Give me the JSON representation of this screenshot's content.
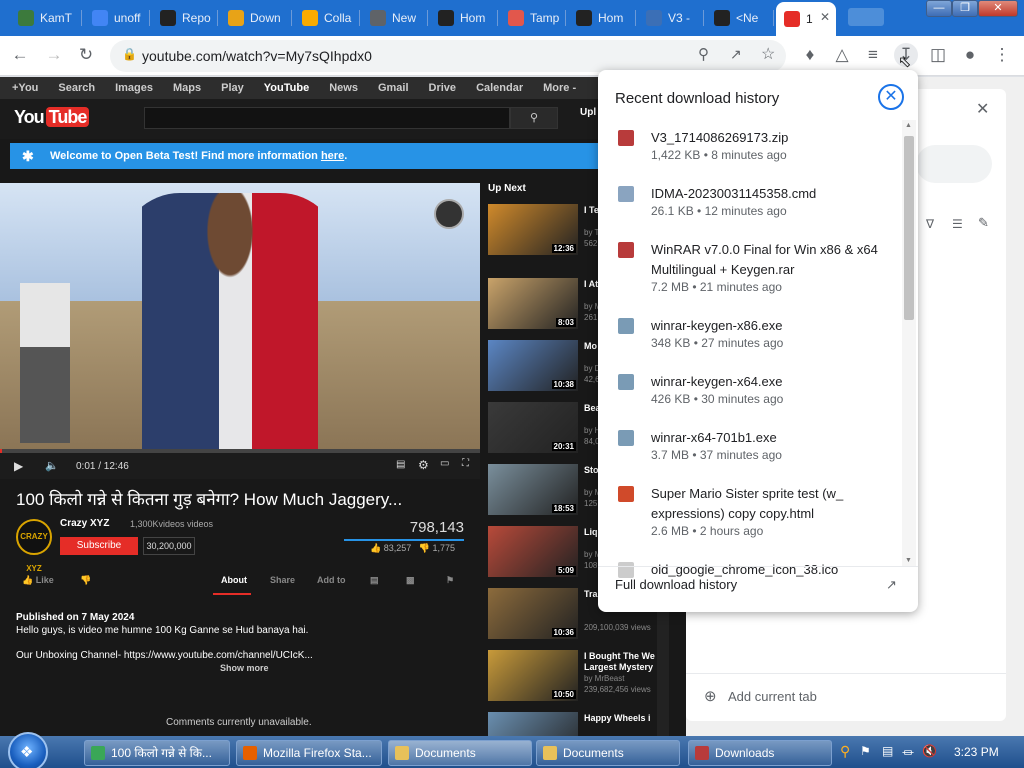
{
  "tabs": [
    {
      "label": "KamT",
      "icon": "kmt-icon",
      "color": "#3c7a3c"
    },
    {
      "label": "unoff",
      "icon": "google-icon",
      "color": "#4285f4"
    },
    {
      "label": "Repo",
      "icon": "github-icon",
      "color": "#222222"
    },
    {
      "label": "Down",
      "icon": "download-site-icon",
      "color": "#e8a317"
    },
    {
      "label": "Colla",
      "icon": "colab-icon",
      "color": "#f9ab00"
    },
    {
      "label": "New",
      "icon": "globe-icon",
      "color": "#5f6368"
    },
    {
      "label": "Hom",
      "icon": "hf-icon",
      "color": "#222222"
    },
    {
      "label": "Tamp",
      "icon": "tampermonkey-icon",
      "color": "#e2574c"
    },
    {
      "label": "Hom",
      "icon": "hf-icon",
      "color": "#222222"
    },
    {
      "label": "V3 -",
      "icon": "g-icon",
      "color": "#3b6fb6"
    },
    {
      "label": "<Ne",
      "icon": "hf-icon",
      "color": "#222222"
    },
    {
      "label": "1",
      "icon": "youtube-icon",
      "color": "#e52d27"
    }
  ],
  "window_controls": {
    "minimize": "—",
    "maximize": "❐",
    "close": "✕"
  },
  "toolbar": {
    "url": "youtube.com/watch?v=My7sQIhpdx0"
  },
  "google_bar": [
    "+You",
    "Search",
    "Images",
    "Maps",
    "Play",
    "YouTube",
    "News",
    "Gmail",
    "Drive",
    "Calendar",
    "More -"
  ],
  "youtube": {
    "logo_you": "You",
    "logo_tube": "Tube",
    "upload": "Upl",
    "banner_text": "Welcome to Open Beta Test! Find more information ",
    "banner_link": "here",
    "banner_end": ".",
    "time": "0:01 / 12:46",
    "title": "100 किलो गन्ने से कितना गुड़ बनेगा? How Much Jaggery...",
    "channel": "Crazy XYZ",
    "channel_avatar": "CRAZY XYZ",
    "channel_videos": "1,300Kvideos videos",
    "subscribe": "Subscribe",
    "sub_count": "30,200,000",
    "views": "798,143",
    "likes": "83,257",
    "dislikes": "1,775",
    "actions": {
      "like": "Like",
      "about": "About",
      "share": "Share",
      "addto": "Add to"
    },
    "published": "Published on 7 May 2024",
    "desc1": "Hello guys, is video me humne 100 Kg Ganne se Hud banaya hai.",
    "desc2": "Our Unboxing Channel- https://www.youtube.com/channel/UCIcK...",
    "show_more": "Show more",
    "comments": "Comments currently unavailable.",
    "up_next": "Up Next",
    "related": [
      {
        "title": "I Te Uni",
        "sub": "by T",
        "views": "562",
        "dur": "12:36",
        "color": "#d08a2b"
      },
      {
        "title": "I At Slic",
        "sub": "by M",
        "views": "261",
        "dur": "8:03",
        "color": "#c9a36a"
      },
      {
        "title": "Mo Dub",
        "sub": "by D",
        "views": "42,6",
        "dur": "10:38",
        "color": "#5b86c4"
      },
      {
        "title": "Bea Gar",
        "sub": "by H",
        "views": "84,0",
        "dur": "20:31",
        "color": "#3a3a3a"
      },
      {
        "title": "Sto Lan",
        "sub": "by M",
        "views": "125",
        "dur": "18:53",
        "color": "#7a8f9c"
      },
      {
        "title": "Liq Flu",
        "sub": "by M",
        "views": "108",
        "dur": "5:09",
        "color": "#b84a3a"
      },
      {
        "title": "Tra",
        "sub": "",
        "views": "209,100,039 views",
        "dur": "10:36",
        "color": "#8c6b3c"
      },
      {
        "title": "I Bought The We Largest Mystery",
        "sub": "by MrBeast",
        "views": "239,682,456 views",
        "dur": "10:50",
        "color": "#c89a3a"
      },
      {
        "title": "Happy Wheels i",
        "sub": "",
        "views": "",
        "dur": "",
        "color": "#6a8fb0"
      }
    ]
  },
  "downloads": {
    "title": "Recent download history",
    "items": [
      {
        "name": "V3_1714086269173.zip",
        "info": "1,422 KB • 8 minutes ago",
        "icon": "winrar-icon",
        "color": "#b83b3b"
      },
      {
        "name": "IDMA-20230031145358.cmd",
        "info": "26.1 KB • 12 minutes ago",
        "icon": "cmd-file-icon",
        "color": "#8aa4c0"
      },
      {
        "name": "WinRAR v7.0.0 Final for Win x86 & x64 Multilingual + Keygen.rar",
        "info": "7.2 MB • 21 minutes ago",
        "icon": "winrar-icon",
        "color": "#b83b3b"
      },
      {
        "name": "winrar-keygen-x86.exe",
        "info": "348 KB • 27 minutes ago",
        "icon": "exe-file-icon",
        "color": "#7a9bb5"
      },
      {
        "name": "winrar-keygen-x64.exe",
        "info": "426 KB • 30 minutes ago",
        "icon": "exe-file-icon",
        "color": "#7a9bb5"
      },
      {
        "name": "winrar-x64-701b1.exe",
        "info": "3.7 MB • 37 minutes ago",
        "icon": "exe-file-icon",
        "color": "#7a9bb5"
      },
      {
        "name": "Super Mario Sister sprite test (w_ expressions) copy copy.html",
        "info": "2.6 MB • 2 hours ago",
        "icon": "html-file-icon",
        "color": "#d04a2a"
      },
      {
        "name": "old_google_chrome_icon_38.ico",
        "info": "",
        "icon": "ico-file-icon",
        "color": "#cccccc"
      }
    ],
    "full_history": "Full download history"
  },
  "side_panel": {
    "add_tab": "Add current tab"
  },
  "taskbar": {
    "tasks": [
      {
        "label": "100 किलो गन्ने से कि...",
        "icon": "chrome-icon",
        "color": "#3aa757"
      },
      {
        "label": "Mozilla Firefox Sta...",
        "icon": "firefox-icon",
        "color": "#e66000"
      },
      {
        "label": "Documents",
        "icon": "folder-icon",
        "color": "#e8c15a"
      },
      {
        "label": "Documents",
        "icon": "folder-icon",
        "color": "#e8c15a"
      },
      {
        "label": "Downloads",
        "icon": "winrar-icon",
        "color": "#b83b3b"
      }
    ],
    "clock": "3:23 PM"
  }
}
